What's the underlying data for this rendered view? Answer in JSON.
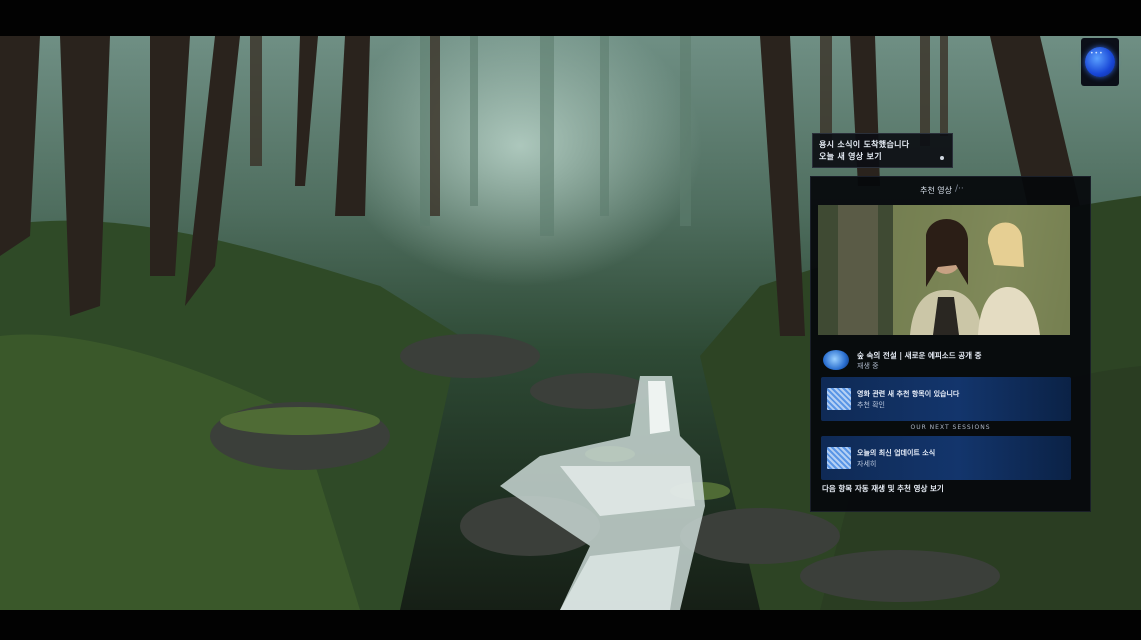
{
  "assistant": {
    "icon": "assistant-orb-icon",
    "dots": "•••"
  },
  "toast": {
    "line1": "용시 소식이 도착했습니다",
    "line2": "오늘 새 영상 보기"
  },
  "panel": {
    "title": "추천 영상",
    "close_glyph": "/··",
    "now_playing": {
      "icon": "media-orb-icon",
      "title": "숲 속의 전설 | 새로운 에피소드 공개 중",
      "subtitle": "재생 중"
    },
    "cards": [
      {
        "icon": "pattern-icon",
        "line1": "영화 관련 새 추천 항목이 있습니다",
        "line2": "추천 확인"
      },
      {
        "icon": "pattern-icon",
        "line1": "오늘의 최신 업데이트 소식",
        "line2": "자세히"
      }
    ],
    "section_label": "OUR NEXT SESSIONS",
    "footer": "다음 항목 자동 재생 및 추천 영상 보기"
  },
  "colors": {
    "accent": "#1846d6",
    "card_bg": "#13356c",
    "panel_bg": "#06080c"
  }
}
